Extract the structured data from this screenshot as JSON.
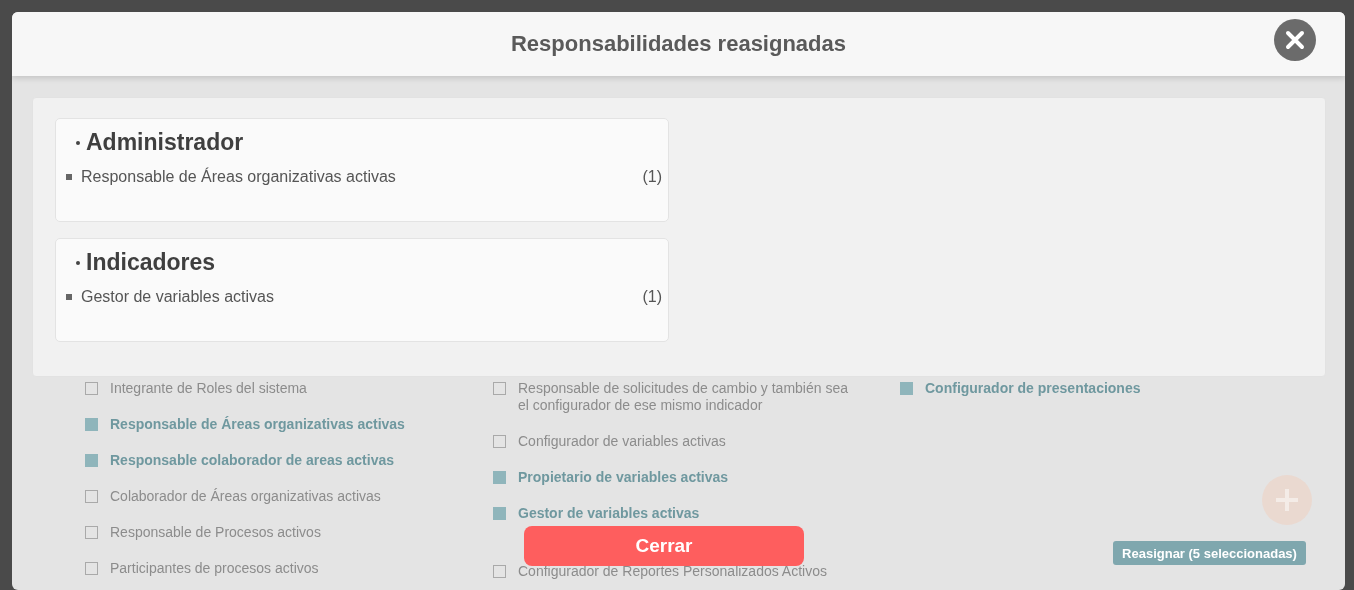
{
  "dialog": {
    "title": "Responsabilidades reasignadas",
    "groups": [
      {
        "name": "Administrador",
        "items": [
          {
            "label": "Responsable de Áreas organizativas activas",
            "count": "(1)"
          }
        ]
      },
      {
        "name": "Indicadores",
        "items": [
          {
            "label": "Gestor de variables activas",
            "count": "(1)"
          }
        ]
      }
    ],
    "button": "Cerrar"
  },
  "background": {
    "columns": [
      {
        "items": [
          {
            "label": "Integrante de Roles del sistema",
            "checked": false
          },
          {
            "label": "Responsable de Áreas organizativas activas",
            "checked": true
          },
          {
            "label": "Responsable colaborador de areas activas",
            "checked": true
          },
          {
            "label": "Colaborador de Áreas organizativas activas",
            "checked": false
          },
          {
            "label": "Responsable de Procesos activos",
            "checked": false
          },
          {
            "label": "Participantes de procesos activos",
            "checked": false
          }
        ]
      },
      {
        "items": [
          {
            "label": "Responsable de solicitudes de cambio y también sea el configurador de ese mismo indicador",
            "checked": false
          },
          {
            "label": "Configurador de variables activas",
            "checked": false
          },
          {
            "label": "Propietario de variables activas",
            "checked": true
          },
          {
            "label": "Gestor de variables activas",
            "checked": true
          },
          {
            "label": "Configurador de Reportes Personalizados Activos",
            "checked": false
          }
        ]
      },
      {
        "items": [
          {
            "label": "Configurador de presentaciones",
            "checked": true
          }
        ]
      }
    ],
    "reassign_button": "Reasignar (5 seleccionadas)"
  }
}
